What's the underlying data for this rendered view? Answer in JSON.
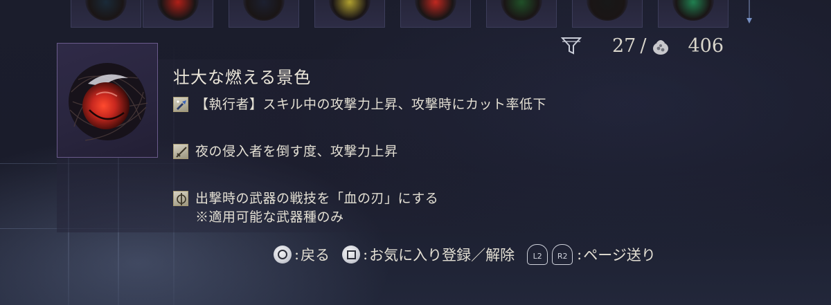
{
  "counter": {
    "current": "27",
    "separator": "/",
    "total": "406"
  },
  "icons": {
    "filter": "filter-icon",
    "bag": "relic-bag-icon"
  },
  "relic": {
    "name": "壮大な燃える景色",
    "gem_color": "#c8281f",
    "effects": [
      {
        "icon": "executor-skill-icon",
        "text": "【執行者】スキル中の攻撃力上昇、攻撃時にカット率低下"
      },
      {
        "icon": "sword-icon",
        "text": "夜の侵入者を倒す度、攻撃力上昇"
      },
      {
        "icon": "weapon-skill-icon",
        "text": "出撃時の武器の戦技を「血の刃」にする",
        "note": "※適用可能な武器種のみ"
      }
    ]
  },
  "relic_strip": {
    "gem_colors": [
      "#1a2a38",
      "#b02018",
      "#1c2030",
      "#b0a030",
      "#c02820",
      "#205028",
      "#181818",
      "#208050"
    ]
  },
  "hints": {
    "back_sep": ":",
    "back": "戻る",
    "favorite_sep": ":",
    "favorite": "お気に入り登録／解除",
    "page_l": "L2",
    "page_r": "R2",
    "page_sep": ":",
    "page": "ページ送り"
  }
}
